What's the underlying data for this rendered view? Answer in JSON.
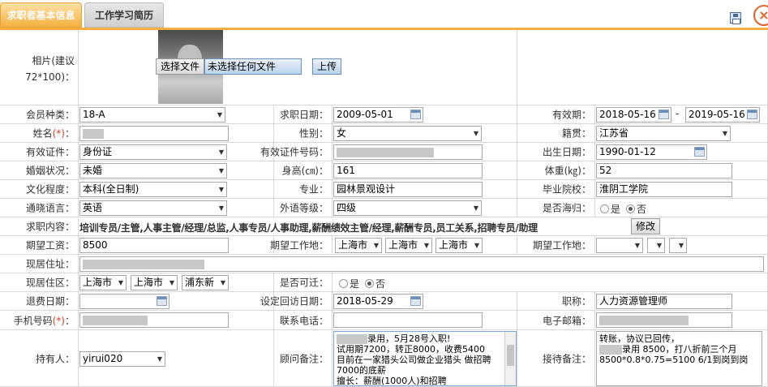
{
  "tabs": [
    {
      "label": "求职者基本信息"
    },
    {
      "label": "工作学习简历"
    }
  ],
  "toolbar": {
    "close_glyph": "×"
  },
  "photo": {
    "label_line1": "相片(建议",
    "label_line2": "72*100)：",
    "choose_button": "选择文件",
    "file_status": "未选择任何文件",
    "upload_button": "上传"
  },
  "fields": {
    "member_type": {
      "label": "会员种类：",
      "value": "18-A"
    },
    "job_date": {
      "label": "求职日期：",
      "value": "2009-05-01"
    },
    "valid_period": {
      "label": "有效期：",
      "start": "2018-05-16",
      "sep": "-",
      "end": "2019-05-16"
    },
    "name": {
      "label": "姓名",
      "req": "(*)",
      "colon": "："
    },
    "gender": {
      "label": "性别：",
      "value": "女"
    },
    "native_place": {
      "label": "籍贯：",
      "value": "江苏省"
    },
    "id_type": {
      "label": "有效证件：",
      "value": "身份证"
    },
    "id_number": {
      "label": "有效证件号码："
    },
    "birth_date": {
      "label": "出生日期：",
      "value": "1990-01-12"
    },
    "marital": {
      "label": "婚姻状况：",
      "value": "未婚"
    },
    "height": {
      "label": "身高(㎝)：",
      "value": "161"
    },
    "weight": {
      "label": "体重(㎏)：",
      "value": "52"
    },
    "education": {
      "label": "文化程度：",
      "value": "本科(全日制)"
    },
    "major": {
      "label": "专业：",
      "value": "园林景观设计"
    },
    "school": {
      "label": "毕业院校：",
      "value": "淮阴工学院"
    },
    "language": {
      "label": "通晓语言：",
      "value": "英语"
    },
    "foreign_level": {
      "label": "外语等级：",
      "value": "四级"
    },
    "overseas": {
      "label": "是否海归：",
      "yes": "是",
      "no": "否"
    },
    "job_content": {
      "label": "求职内容：",
      "value": "培训专员/主管,人事主管/经理/总监,人事专员/人事助理,薪酬绩效主管/经理,薪酬专员,员工关系,招聘专员/助理",
      "edit_button": "修改"
    },
    "salary": {
      "label": "期望工资：",
      "value": "8500"
    },
    "work_place": {
      "label": "期望工作地：",
      "province": "上海市",
      "city": "上海市",
      "district": "上海市"
    },
    "work_place2": {
      "label": "期望工作地："
    },
    "residence": {
      "label": "现居住址："
    },
    "residence_area": {
      "label": "现居住区：",
      "province": "上海市",
      "city": "上海市",
      "district": "浦东新"
    },
    "relocate": {
      "label": "是否可迁：",
      "yes": "是",
      "no": "否"
    },
    "refund_date": {
      "label": "退费日期："
    },
    "visit_date": {
      "label": "设定回访日期：",
      "value": "2018-05-29"
    },
    "title": {
      "label": "职称：",
      "value": "人力资源管理师"
    },
    "mobile": {
      "label": "手机号码",
      "req": "(*)",
      "colon": "："
    },
    "phone": {
      "label": "联系电话："
    },
    "email": {
      "label": "电子邮箱："
    },
    "holder": {
      "label": "持有人：",
      "value": "yirui020"
    },
    "advisor_note": {
      "label": "顾问备注：",
      "line1": "录用，5月28号入职!",
      "line2": "试用期7200，转正8000，收费5400",
      "line3": "目前在一家猎头公司做企业猎头 做招聘 7000的底薪",
      "line4": "擅长：薪酬(1000人)和招聘"
    },
    "reception_note": {
      "label": "接待备注：",
      "line1": "转账，协议已回传，",
      "line2": "录用  8500，打八折前三个月",
      "line3": "8500*0.8*0.75=5100 6/1到岗到岗"
    }
  }
}
